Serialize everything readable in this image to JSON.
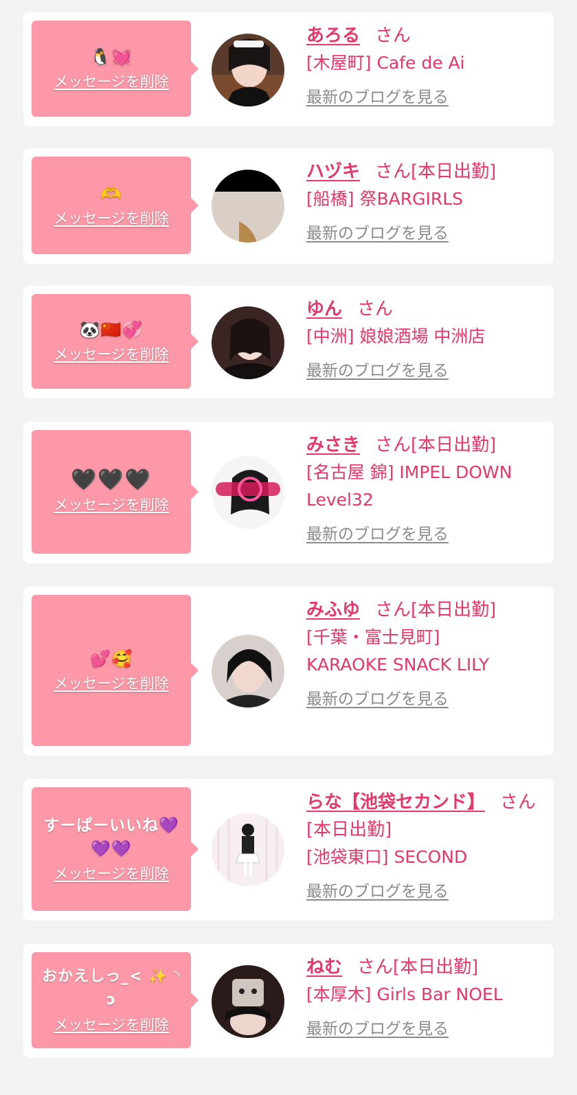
{
  "delete_label": "メッセージを削除",
  "blog_label": "最新のブログを見る",
  "san_label": "さん",
  "today_label": "[本日出勤]",
  "colors": {
    "bubble": "#fc98a7",
    "accent": "#e5386a",
    "blog": "#8a8a8a",
    "background": "#f3f3f3"
  },
  "messages": [
    {
      "bubble_text": "🐧💓",
      "name": "あろる",
      "today": "",
      "shop": "[木屋町] Cafe de Ai"
    },
    {
      "bubble_text": "🫶",
      "name": "ハヅキ",
      "today": "[本日出勤]",
      "shop": "[船橋] 祭BARGIRLS"
    },
    {
      "bubble_text": "🐼🇨🇳💞",
      "name": "ゆん",
      "today": "",
      "shop": "[中洲] 娘娘酒場 中洲店"
    },
    {
      "bubble_text": "🖤🖤🖤",
      "name": "みさき",
      "today": "[本日出勤]",
      "shop": "[名古屋 錦] IMPEL DOWN Level32"
    },
    {
      "bubble_text": "💕🥰",
      "name": "みふゆ",
      "today": "[本日出勤]",
      "shop": "[千葉・富士見町] KARAOKE SNACK LILY"
    },
    {
      "bubble_text": "すーぱーいいね💜💜💜",
      "name": "らな【池袋セカンド】",
      "today": "[本日出勤]",
      "shop": "[池袋東口] SECOND"
    },
    {
      "bubble_text": "おかえしっ_< ✨ ◝ ɔ",
      "name": "ねむ",
      "today": "[本日出勤]",
      "shop": "[本厚木] Girls Bar NOEL"
    }
  ]
}
